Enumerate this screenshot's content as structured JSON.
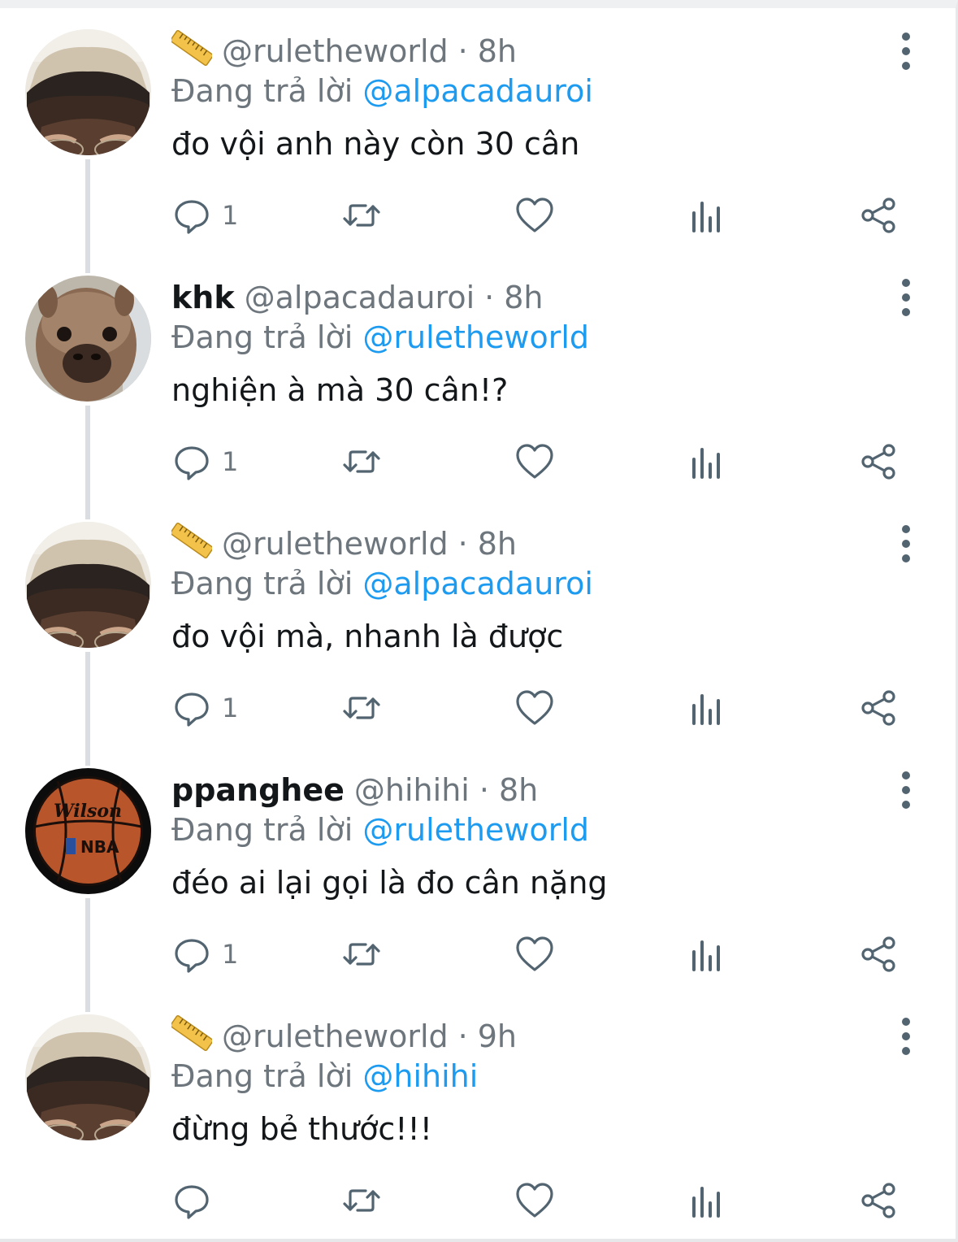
{
  "accent_color": "#1d9bf0",
  "reply_prefix": "Đang trả lời",
  "tweets": [
    {
      "avatar": "person-hat-avatar",
      "ruler_emoji": true,
      "name": "",
      "handle": "@ruletheworld",
      "separator": "·",
      "time": "8h",
      "reply_to": "@alpacadauroi",
      "text": "đo vội anh này còn 30 cân",
      "reply_count": "1"
    },
    {
      "avatar": "alpaca-avatar",
      "ruler_emoji": false,
      "name": "khk",
      "handle": "@alpacadauroi",
      "separator": "·",
      "time": "8h",
      "reply_to": "@ruletheworld",
      "text": "nghiện à mà 30 cân!?",
      "reply_count": "1"
    },
    {
      "avatar": "person-hat-avatar",
      "ruler_emoji": true,
      "name": "",
      "handle": "@ruletheworld",
      "separator": "·",
      "time": "8h",
      "reply_to": "@alpacadauroi",
      "text": "đo vội mà, nhanh là được",
      "reply_count": "1"
    },
    {
      "avatar": "basketball-avatar",
      "avatar_logo_text": "Wilson",
      "avatar_logo_text_2": "NBA",
      "ruler_emoji": false,
      "name": "ppanghee",
      "handle": "@hihihi",
      "separator": "·",
      "time": "8h",
      "reply_to": "@ruletheworld",
      "text": "đéo ai lại gọi là đo cân nặng",
      "reply_count": "1"
    },
    {
      "avatar": "person-hat-avatar",
      "ruler_emoji": true,
      "name": "",
      "handle": "@ruletheworld",
      "separator": "·",
      "time": "9h",
      "reply_to": "@hihihi",
      "text": "đừng bẻ thước!!!",
      "reply_count": ""
    }
  ]
}
